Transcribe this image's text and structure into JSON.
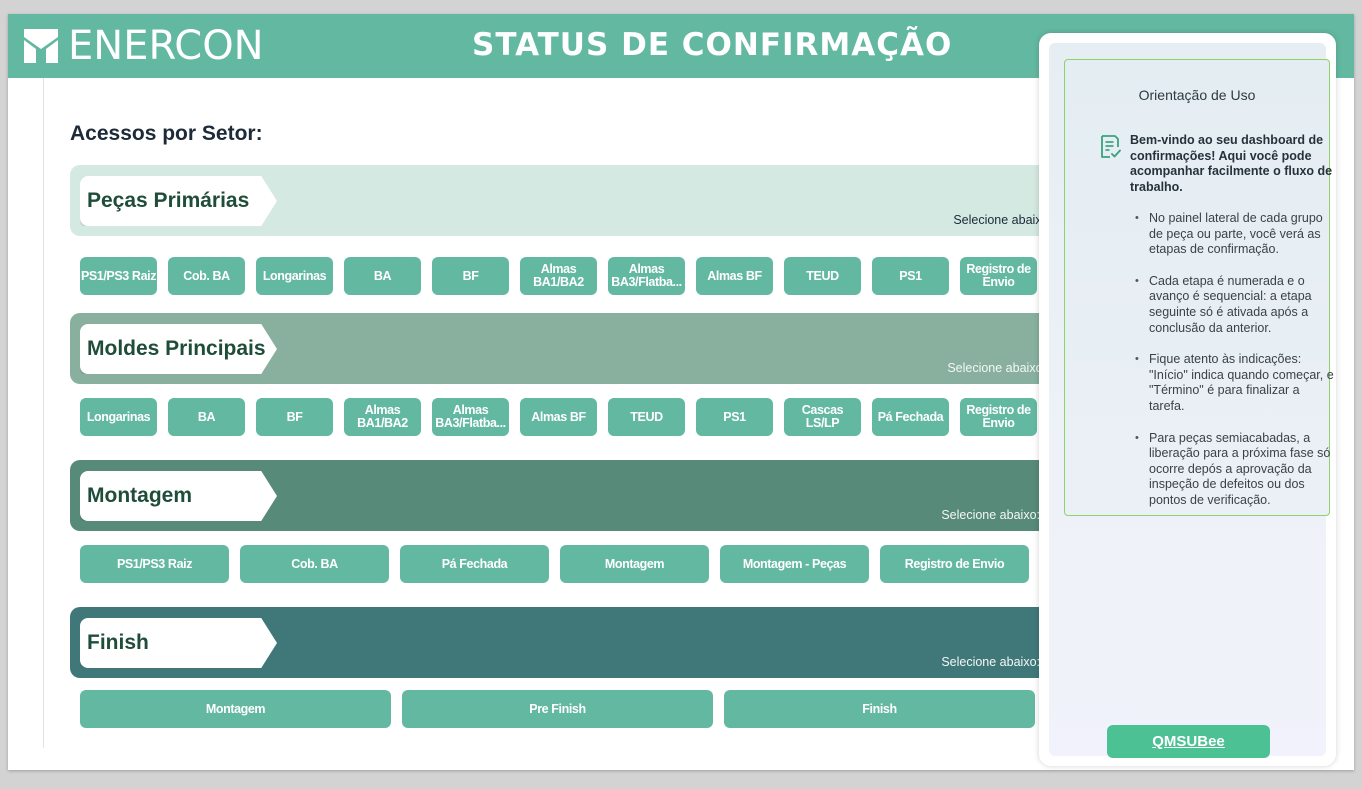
{
  "header": {
    "brand": "ENERCON",
    "title": "STATUS DE CONFIRMAÇÃO"
  },
  "main": {
    "heading": "Acessos por Setor:",
    "select_hint": "Selecione abaixo:",
    "sectors": [
      {
        "name": "Peças Primárias",
        "color": "#d4e9e1",
        "buttons": [
          "PS1/PS3 Raiz",
          "Cob. BA",
          "Longarinas",
          "BA",
          "BF",
          "Almas BA1/BA2",
          "Almas BA3/Flatba...",
          "Almas BF",
          "TEUD",
          "PS1",
          "Registro de Envio"
        ]
      },
      {
        "name": "Moldes Principais",
        "color": "#89b09f",
        "buttons": [
          "Longarinas",
          "BA",
          "BF",
          "Almas BA1/BA2",
          "Almas BA3/Flatba...",
          "Almas BF",
          "TEUD",
          "PS1",
          "Cascas LS/LP",
          "Pá Fechada",
          "Registro de Envio"
        ]
      },
      {
        "name": "Montagem",
        "color": "#578a79",
        "buttons": [
          "PS1/PS3 Raiz",
          "Cob. BA",
          "Pá Fechada",
          "Montagem",
          "Montagem - Peças",
          "Registro de Envio"
        ]
      },
      {
        "name": "Finish",
        "color": "#40787a",
        "buttons": [
          "Montagem",
          "Pre Finish",
          "Finish"
        ]
      }
    ]
  },
  "guide": {
    "title": "Orientação de Uso",
    "welcome": "Bem-vindo ao seu dashboard de confirmações! Aqui você pode acompanhar facilmente o fluxo de trabalho.",
    "bullets": [
      "No painel lateral de cada grupo de peça ou parte, você verá as etapas de confirmação.",
      "Cada etapa é numerada e o avanço é sequencial: a etapa seguinte só é ativada após a conclusão da anterior.",
      "Fique atento às indicações: \"Início\" indica quando começar, e \"Término\" é para finalizar a tarefa.",
      "Para peças semiacabadas, a liberação para a próxima fase só ocorre depós a aprovação da inspeção de defeitos ou dos pontos de verificação."
    ],
    "link_label": "QMSUBee"
  },
  "colors": {
    "accent": "#63b8a1",
    "button": "#63b8a1",
    "link_button": "#4cc194"
  },
  "icons": {
    "brand": "enercon-logo-icon",
    "guide": "document-check-icon"
  }
}
